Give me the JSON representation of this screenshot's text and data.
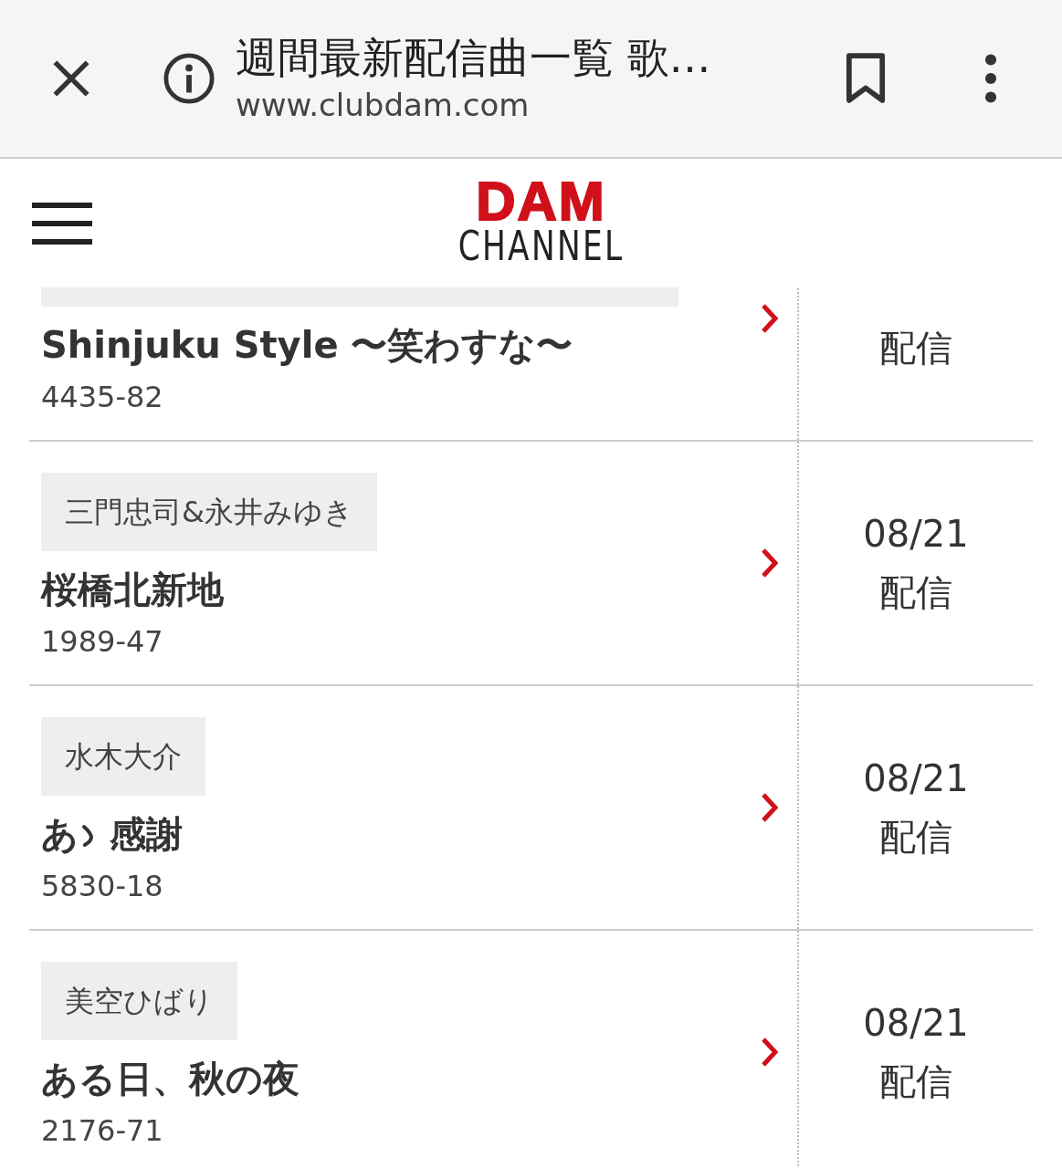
{
  "browser_bar": {
    "title": "週間最新配信曲一覧 歌…",
    "url": "www.clubdam.com"
  },
  "site_header": {
    "logo_top": "DAM",
    "logo_bottom": "CHANNEL"
  },
  "songs": [
    {
      "artist_hidden": true,
      "title": "Shinjuku Style 〜笑わすな〜",
      "number": "4435-82",
      "status": "配信"
    },
    {
      "artist": "三門忠司&永井みゆき",
      "title": "桜橋北新地",
      "number": "1989-47",
      "date": "08/21",
      "status": "配信"
    },
    {
      "artist": "水木大介",
      "title_parts": [
        {
          "kind": "text",
          "text": "あ"
        },
        {
          "kind": "iteration_mark"
        },
        {
          "kind": "text",
          "text": " 感謝"
        }
      ],
      "number": "5830-18",
      "date": "08/21",
      "status": "配信"
    },
    {
      "artist": "美空ひばり",
      "title": "ある日、秋の夜",
      "number": "2176-71",
      "date": "08/21",
      "status": "配信"
    }
  ]
}
